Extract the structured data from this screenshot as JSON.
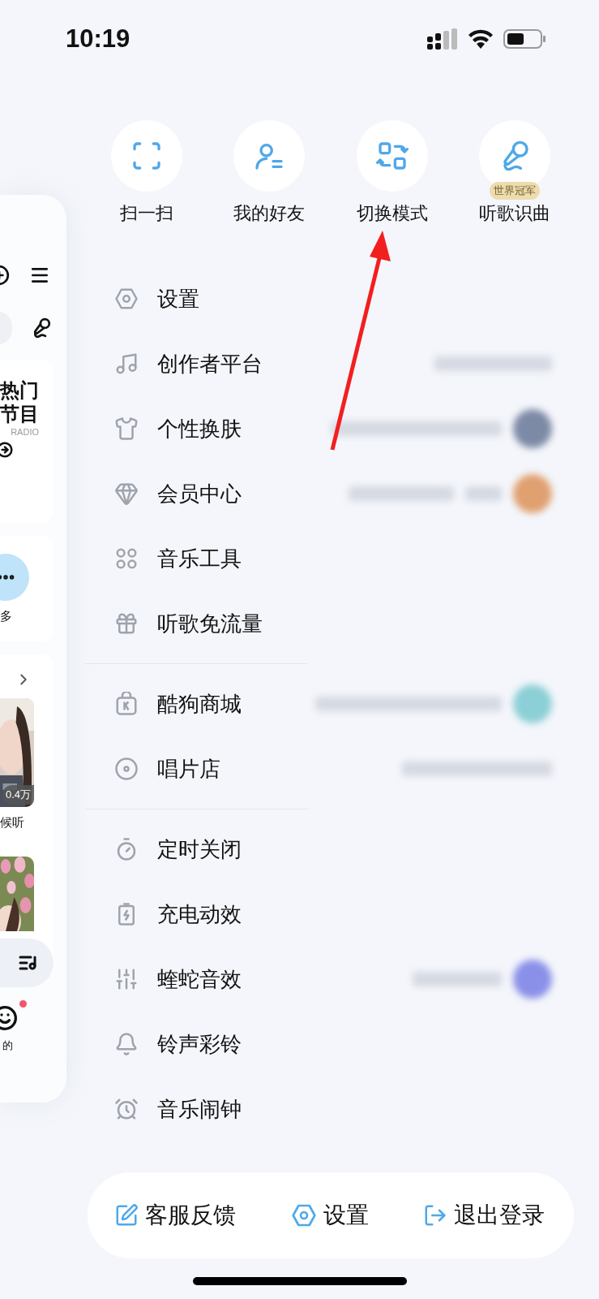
{
  "status_bar": {
    "time": "10:19"
  },
  "background_page": {
    "radio_card": {
      "title_lines": [
        "热门",
        "节目"
      ],
      "subtitle": "RADIO"
    },
    "more_label": "多",
    "play_count": "0.4万",
    "caption": "候听",
    "nav_label": "的",
    "has_notification": true
  },
  "quick_actions": [
    {
      "label": "扫一扫"
    },
    {
      "label": "我的好友"
    },
    {
      "label": "切换模式"
    },
    {
      "label": "听歌识曲",
      "badge": "世界冠军"
    }
  ],
  "menu_groups": [
    {
      "items": [
        {
          "label": "设置"
        },
        {
          "label": "创作者平台"
        },
        {
          "label": "个性换肤"
        },
        {
          "label": "会员中心"
        },
        {
          "label": "音乐工具"
        },
        {
          "label": "听歌免流量"
        }
      ]
    },
    {
      "items": [
        {
          "label": "酷狗商城"
        },
        {
          "label": "唱片店"
        }
      ]
    },
    {
      "items": [
        {
          "label": "定时关闭"
        },
        {
          "label": "充电动效"
        },
        {
          "label": "蝰蛇音效"
        },
        {
          "label": "铃声彩铃"
        },
        {
          "label": "音乐闹钟"
        }
      ]
    }
  ],
  "bottom_bar": [
    {
      "label": "客服反馈"
    },
    {
      "label": "设置"
    },
    {
      "label": "退出登录"
    }
  ]
}
